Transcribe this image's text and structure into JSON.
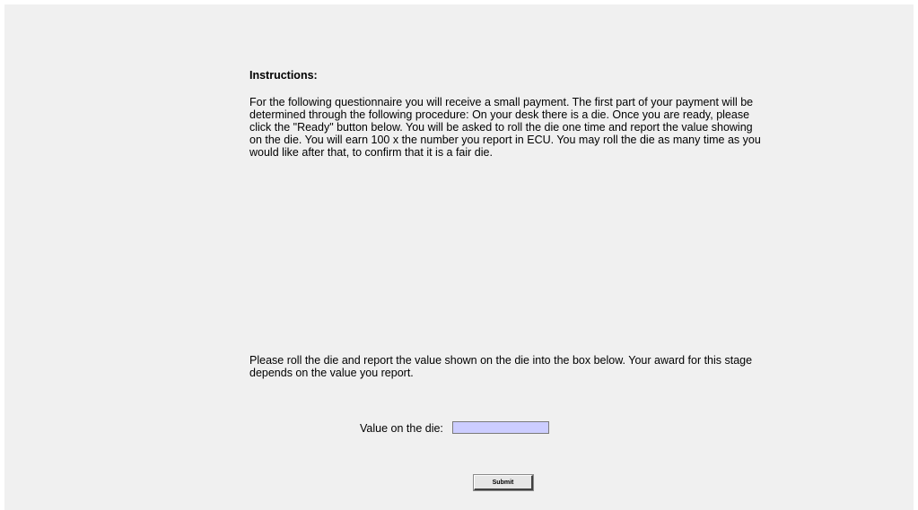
{
  "instructions": {
    "heading": "Instructions:",
    "body": "For the following questionnaire you will receive a small payment. The first part of your payment will be determined through the following procedure: On your desk there is a die. Once you are ready, please click the \"Ready\" button below. You will be asked to roll the die one time and report the value showing on the die. You will earn 100 x the number you report in ECU. You may roll the die as many time as you would like after that, to confirm that it is a fair die."
  },
  "task": {
    "prompt": "Please roll the die and report the value shown on the die into the box below. Your award for this stage depends on the value you report."
  },
  "form": {
    "value_label": "Value on the die:",
    "value_input": "",
    "submit_label": "Submit"
  },
  "colors": {
    "background": "#f0f0f0",
    "input_background": "#cccdff"
  }
}
